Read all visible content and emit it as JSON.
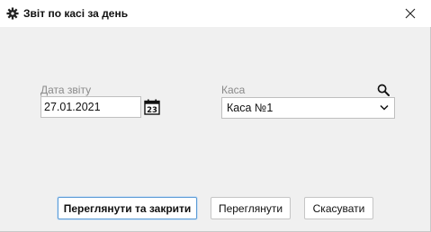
{
  "window": {
    "title": "Звіт по касі за день",
    "icons": {
      "title": "gear-icon",
      "close": "close-icon"
    }
  },
  "form": {
    "date": {
      "label": "Дата звіту",
      "value": "27.01.2021",
      "picker_icon": "calendar-icon",
      "picker_day": "23"
    },
    "cash": {
      "label": "Каса",
      "value": "Каса №1",
      "search_icon": "search-icon",
      "dropdown_icon": "chevron-down-icon"
    }
  },
  "buttons": {
    "view_close": "Переглянути та закрити",
    "view": "Переглянути",
    "cancel": "Скасувати"
  },
  "colors": {
    "background": "#f0f0f0",
    "titlebar": "#ffffff",
    "label": "#8a8a8a",
    "focus_border": "#5b9bd5"
  }
}
